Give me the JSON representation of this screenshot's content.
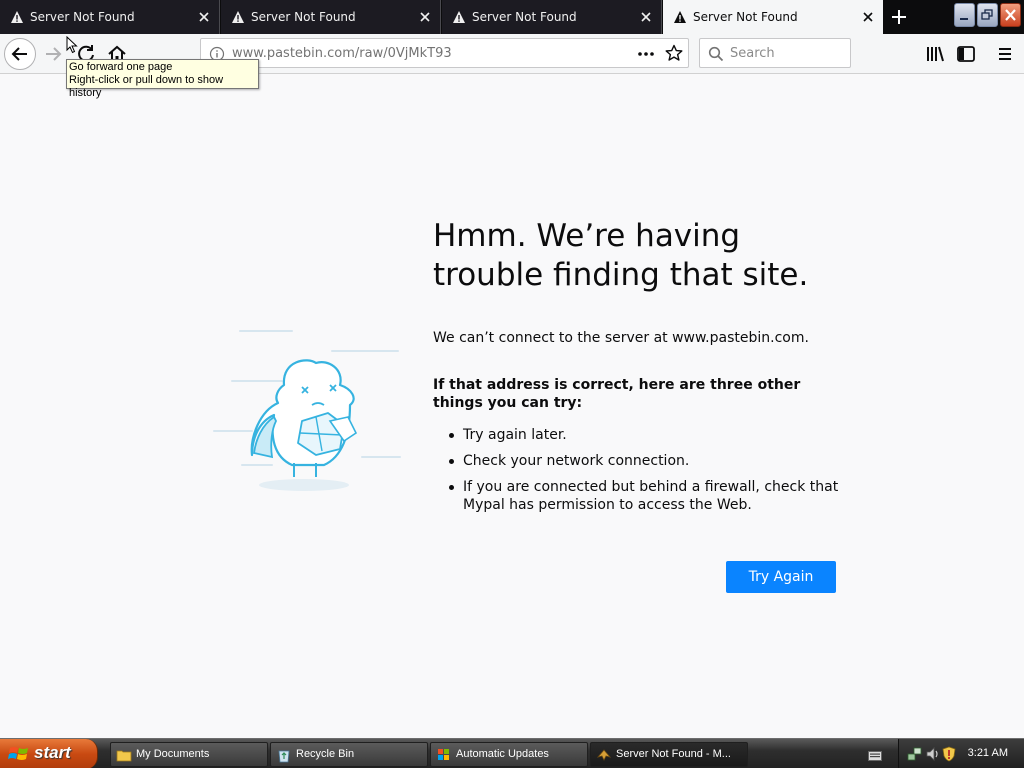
{
  "browser": {
    "tabs": [
      {
        "title": "Server Not Found",
        "active": false
      },
      {
        "title": "Server Not Found",
        "active": false
      },
      {
        "title": "Server Not Found",
        "active": false
      },
      {
        "title": "Server Not Found",
        "active": true
      }
    ],
    "url": "www.pastebin.com/raw/0VjMkT93",
    "search_placeholder": "Search",
    "tooltip": {
      "line1": "Go forward one page",
      "line2": "Right-click or pull down to show history"
    }
  },
  "error_page": {
    "title": "Hmm. We’re having trouble finding that site.",
    "description": "We can’t connect to the server at www.pastebin.com.",
    "hint": "If that address is correct, here are three other things you can try:",
    "suggestions": [
      "Try again later.",
      "Check your network connection.",
      "If you are connected but behind a firewall, check that Mypal has permission to access the Web."
    ],
    "try_again_label": "Try Again"
  },
  "taskbar": {
    "start_label": "start",
    "items": [
      {
        "label": "My Documents",
        "icon": "folder-icon"
      },
      {
        "label": "Recycle Bin",
        "icon": "recycle-bin-icon"
      },
      {
        "label": "Automatic Updates",
        "icon": "windows-update-icon"
      },
      {
        "label": "Server Not Found - M...",
        "icon": "mypal-browser-icon"
      }
    ],
    "clock": "3:21 AM"
  },
  "colors": {
    "accent": "#0a84ff",
    "page_background": "#f9f9fa",
    "tab_strip": "#0c0c0d",
    "start_button": "#c94a12"
  }
}
